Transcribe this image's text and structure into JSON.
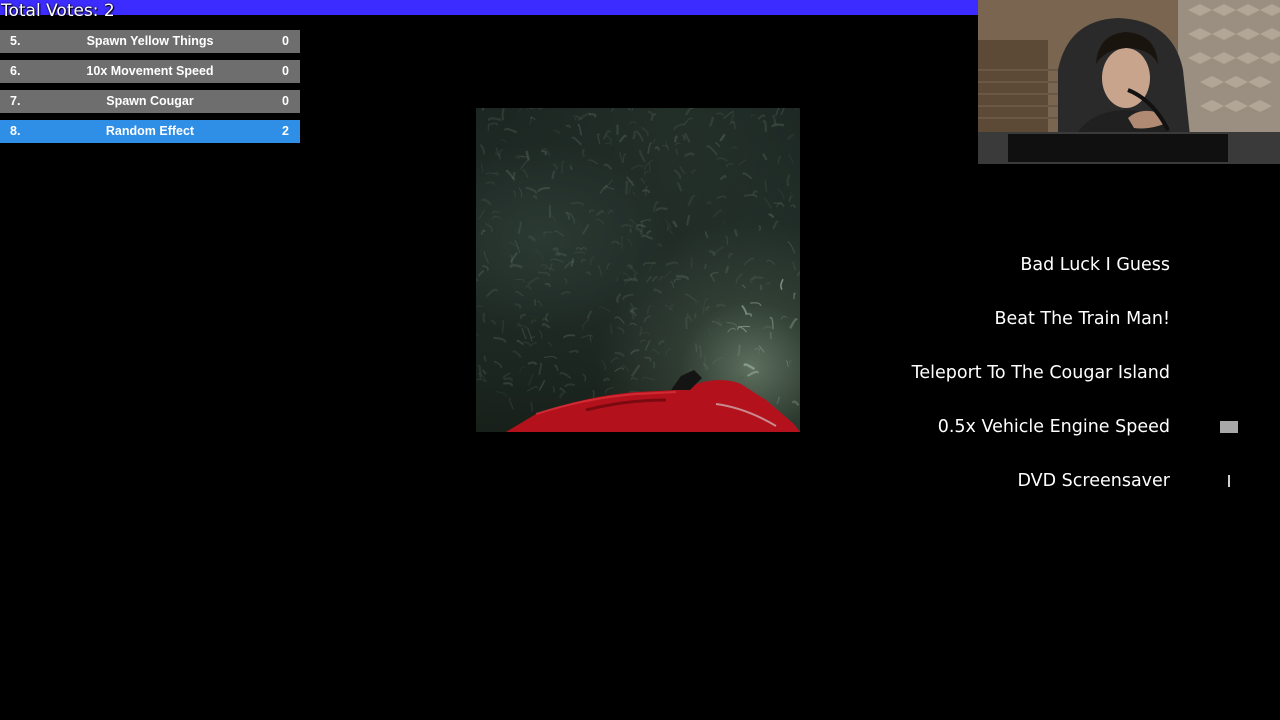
{
  "vote": {
    "total_label": "Total Votes: 2",
    "progress_fraction": 0.764,
    "bar_color": "#3c2cff",
    "options": [
      {
        "num": "5.",
        "label": "Spawn Yellow Things",
        "count": "0",
        "selected": false
      },
      {
        "num": "6.",
        "label": "10x Movement Speed",
        "count": "0",
        "selected": false
      },
      {
        "num": "7.",
        "label": "Spawn Cougar",
        "count": "0",
        "selected": false
      },
      {
        "num": "8.",
        "label": "Random Effect",
        "count": "2",
        "selected": true
      }
    ],
    "option_color": "#6e6e6e",
    "selected_color": "#2f8ee6"
  },
  "effects": [
    {
      "label": "Bad Luck I Guess",
      "timer_fraction": 0
    },
    {
      "label": "Beat The Train Man!",
      "timer_fraction": 0
    },
    {
      "label": "Teleport To The Cougar Island",
      "timer_fraction": 0
    },
    {
      "label": "0.5x Vehicle Engine Speed",
      "timer_fraction": 1.0
    },
    {
      "label": "DVD Screensaver",
      "timer_fraction": 0.1
    }
  ],
  "icons": {
    "webcam": "webcam-feed-icon",
    "game": "game-viewport"
  }
}
